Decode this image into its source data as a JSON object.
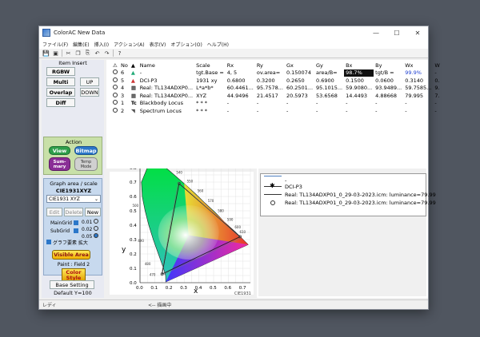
{
  "window": {
    "title": "ColorAC  New Data"
  },
  "menu": [
    "ファイル(F)",
    "編集(E)",
    "挿入(I)",
    "アクション(A)",
    "表示(V)",
    "オプション(O)",
    "ヘルプ(H)"
  ],
  "item_insert": {
    "title": "Item Insert",
    "rgbw": "RGBW",
    "multi": "Multi",
    "overlap": "Overlap",
    "diff": "Diff",
    "up": "UP",
    "down": "DOWN"
  },
  "action": {
    "title": "Action",
    "view": "View",
    "bitmap": "Bitmap",
    "summary": "Sum-\nmary",
    "tempmode": "Temp\nMode"
  },
  "graph": {
    "title": "Graph area / scale",
    "space": "CIE1931XYZ",
    "select_value": "CIE1931 XYZ",
    "edit": "Edit",
    "delete": "Delete",
    "new": "New",
    "maingrid": "MainGrid",
    "subgrid": "SubGrid",
    "maingrid_vals": [
      "0.01",
      "0.02",
      "0.05"
    ],
    "zoom_label": "グラフ要素 拡大"
  },
  "visible_area": {
    "label": "Visible Area",
    "paint": "Paint : Field 2"
  },
  "color_style": {
    "label": "Color\nStyle"
  },
  "base_setting": {
    "label": "Base Setting",
    "default": "Default Y=100"
  },
  "table": {
    "headers": [
      "No",
      "Name",
      "Scale",
      "Rx",
      "Ry",
      "Gx",
      "Gy",
      "Bx",
      "By",
      "Wx",
      "W"
    ],
    "rows": [
      {
        "no": "6",
        "name": "-",
        "scale": "tgt.Base =",
        "rx": "4, 5",
        "ry": "ov.area=",
        "gx": "0.150074",
        "gy": "area/B=",
        "bx": "98.7%",
        "by": "tgt/B =",
        "wx": "99.9%",
        "w": "-"
      },
      {
        "no": "5",
        "name": "DCI-P3",
        "scale": "1931 xy",
        "rx": "0.6800",
        "ry": "0.3200",
        "gx": "0.2650",
        "gy": "0.6900",
        "bx": "0.1500",
        "by": "0.0600",
        "wx": "0.3140",
        "w": "0."
      },
      {
        "no": "4",
        "name": "Real: TL134ADXP0...",
        "scale": "L*a*b*",
        "rx": "60.4461...",
        "ry": "95.7578...",
        "gx": "60.2501...",
        "gy": "95.1015...",
        "bx": "59.9080...",
        "by": "93.9489...",
        "wx": "59.7585...",
        "w": "9."
      },
      {
        "no": "3",
        "name": "Real: TL134ADXP0...",
        "scale": "XYZ",
        "rx": "44.9496",
        "ry": "21.4517",
        "gx": "20.5973",
        "gy": "53.6568",
        "bx": "14.4493",
        "by": "4.88668",
        "wx": "79.995",
        "w": "7."
      },
      {
        "no": "1",
        "name": "Blackbody Locus",
        "scale": "* * *",
        "rx": "-",
        "ry": "-",
        "gx": "-",
        "gy": "-",
        "bx": "-",
        "by": "-",
        "wx": "-",
        "w": "-"
      },
      {
        "no": "2",
        "name": "Spectrum Locus",
        "scale": "* * *",
        "rx": "-",
        "ry": "-",
        "gx": "-",
        "gy": "-",
        "bx": "-",
        "by": "-",
        "wx": "-",
        "w": "-"
      }
    ]
  },
  "legend": {
    "items": [
      "-",
      "DCI-P3",
      "Real: TL134ADXP01_0_29-03-2023.icm: luminance=79.99",
      "Real: TL134ADXP01_0_29-03-2023.icm: luminance=79.99"
    ]
  },
  "chart": {
    "xlabel": "x",
    "ylabel": "y",
    "caption": "CIE1931",
    "xticks": [
      "0.0",
      "0.1",
      "0.2",
      "0.3",
      "0.4",
      "0.5",
      "0.6",
      "0.7"
    ],
    "yticks": [
      "0.0",
      "0.1",
      "0.2",
      "0.3",
      "0.4",
      "0.5",
      "0.6",
      "0.7",
      "0.8"
    ],
    "wavelengths": [
      "520",
      "530",
      "540",
      "550",
      "560",
      "570",
      "580",
      "590",
      "600",
      "610",
      "500",
      "490",
      "480",
      "470"
    ]
  },
  "chart_data": {
    "type": "scatter",
    "xlabel": "x",
    "ylabel": "y",
    "xlim": [
      0.0,
      0.75
    ],
    "ylim": [
      0.0,
      0.85
    ],
    "series": [
      {
        "name": "DCI-P3",
        "values": [
          [
            0.68,
            0.32
          ],
          [
            0.265,
            0.69
          ],
          [
            0.15,
            0.06
          ]
        ]
      }
    ]
  },
  "status": {
    "left": "レディ",
    "center": "<-- 描画中"
  }
}
